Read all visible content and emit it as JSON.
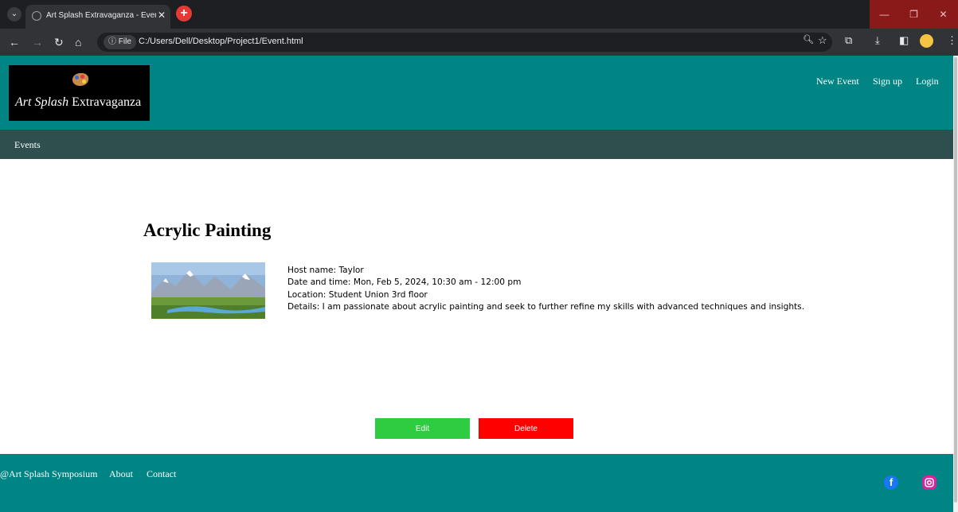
{
  "browser": {
    "tab_title": "Art Splash Extravaganza - Event",
    "close_glyph": "✕",
    "file_chip": "ⓘ File",
    "url": "C:/Users/Dell/Desktop/Project1/Event.html"
  },
  "site": {
    "logo_script": "Art Splash",
    "logo_text": "Extravaganza",
    "nav": [
      "New Event",
      "Sign up",
      "Login"
    ],
    "subnav_label": "Events"
  },
  "event": {
    "title": "Acrylic Painting",
    "host": "Host name: Taylor",
    "datetime": "Date and time: Mon, Feb 5, 2024, 10:30 am - 12:00 pm",
    "location": "Location: Student Union 3rd floor",
    "details": "Details: I am passionate about acrylic painting and seek to further refine my skills with advanced techniques and insights."
  },
  "actions": {
    "edit_label": "Edit",
    "delete_label": "Delete",
    "edit_color": "#2ecc40",
    "delete_color": "#ff0000"
  },
  "footer": {
    "copyright": "@Art Splash Symposium",
    "links": [
      "About",
      "Contact"
    ]
  },
  "colors": {
    "header_teal": "#008484",
    "subnav_dark": "#2f4f4f"
  }
}
